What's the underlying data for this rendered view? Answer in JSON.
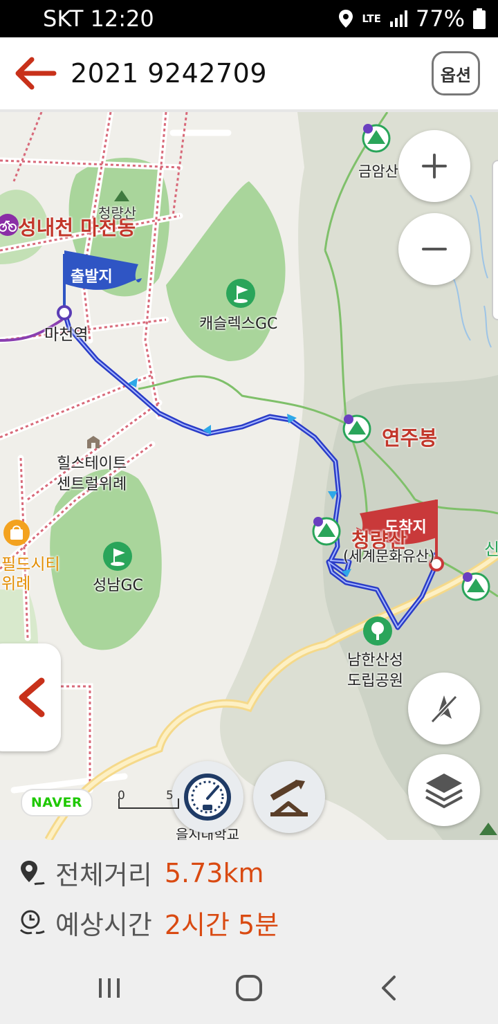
{
  "status_bar": {
    "carrier_time": "SKT 12:20",
    "network": "LTE",
    "battery": "77%"
  },
  "header": {
    "title": "2021 9242709",
    "option_label": "옵션"
  },
  "map": {
    "labels": {
      "bike_place": "성내천 마천동",
      "start_flag": "출발지",
      "station": "마천역",
      "golf1": "캐슬렉스GC",
      "peak1": "연주봉",
      "geumam": "금암산",
      "apartment_l1": "힐스테이트",
      "apartment_l2": "센트럴위례",
      "shop_l1": "필드시티",
      "shop_l2": "위례",
      "golf2": "성남GC",
      "end_flag": "도착지",
      "peak2": "청량산",
      "peak2_sub": "(세계문화유산)",
      "park_l1": "남한산성",
      "park_l2": "도립공원",
      "school": "을지대학교",
      "cheong": "청량산",
      "east_cut": "신"
    },
    "naver_logo": "NAVER",
    "scale_zero": "0",
    "scale_five": "5"
  },
  "summary": {
    "distance_label": "전체거리",
    "distance_value": "5.73km",
    "time_label": "예상시간",
    "time_value": "2시간 5분"
  },
  "colors": {
    "accent": "#d94a12",
    "route": "#2a3cc7",
    "start_flag": "#2f55c4",
    "end_flag": "#c9393a"
  },
  "icons": [
    "back-arrow-icon",
    "zoom-in-icon",
    "zoom-out-icon",
    "collapse-panel-icon",
    "compass-off-icon",
    "layers-icon",
    "speedometer-icon",
    "elevation-icon",
    "distance-pin-icon",
    "time-clock-icon",
    "recent-apps-icon",
    "home-icon",
    "nav-back-icon"
  ]
}
